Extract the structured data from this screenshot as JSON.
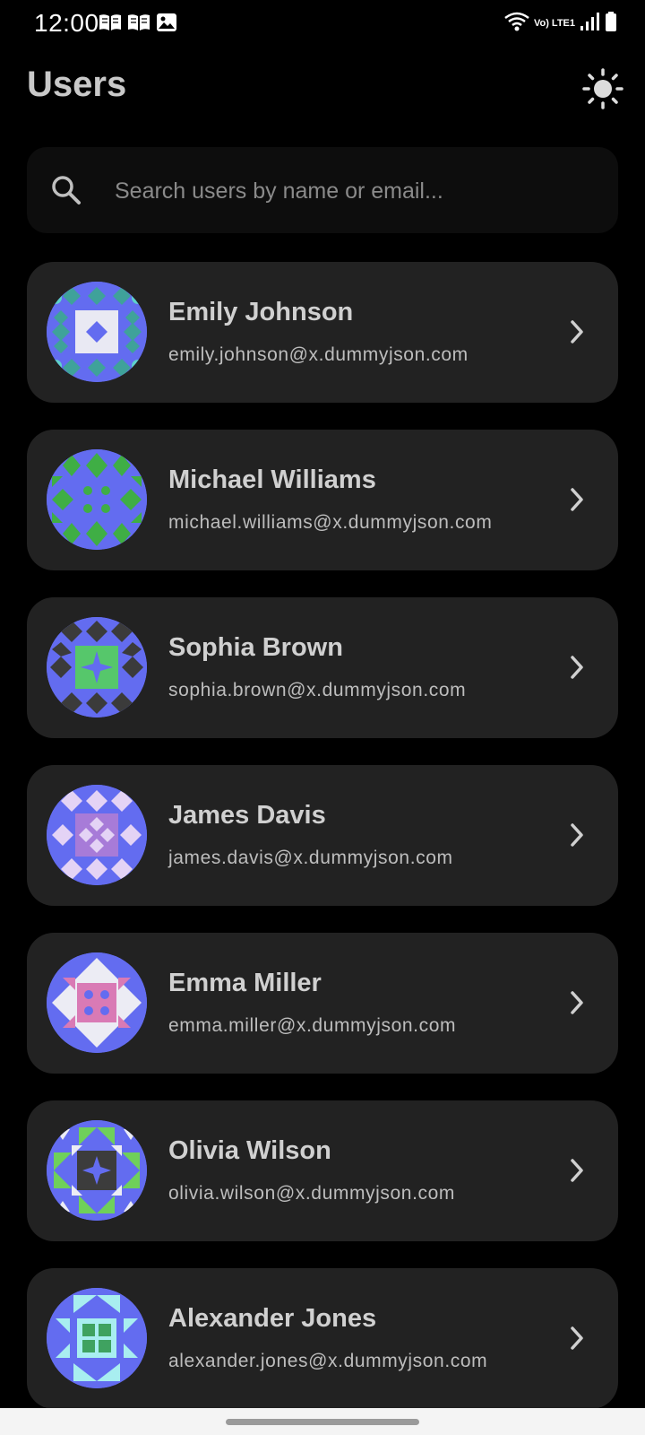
{
  "status_bar": {
    "time": "12:00",
    "left_icons": [
      "book-icon",
      "book-icon",
      "image-icon"
    ],
    "network_label": "Vo) LTE1",
    "right_icons": [
      "wifi-icon",
      "signal-icon",
      "battery-icon"
    ]
  },
  "header": {
    "title": "Users",
    "theme_toggle_icon": "sun-icon"
  },
  "search": {
    "placeholder": "Search users by name or email...",
    "value": "",
    "icon": "search-icon"
  },
  "users": [
    {
      "name": "Emily Johnson",
      "email": "emily.johnson@x.dummyjson.com"
    },
    {
      "name": "Michael Williams",
      "email": "michael.williams@x.dummyjson.com"
    },
    {
      "name": "Sophia Brown",
      "email": "sophia.brown@x.dummyjson.com"
    },
    {
      "name": "James Davis",
      "email": "james.davis@x.dummyjson.com"
    },
    {
      "name": "Emma Miller",
      "email": "emma.miller@x.dummyjson.com"
    },
    {
      "name": "Olivia Wilson",
      "email": "olivia.wilson@x.dummyjson.com"
    },
    {
      "name": "Alexander Jones",
      "email": "alexander.jones@x.dummyjson.com"
    }
  ],
  "colors": {
    "background": "#000000",
    "card": "#222222",
    "search_bg": "#0d0d0d",
    "avatar_base": "#636cf0",
    "text_primary": "#d0d0d0",
    "text_secondary": "#bdbdbd"
  }
}
